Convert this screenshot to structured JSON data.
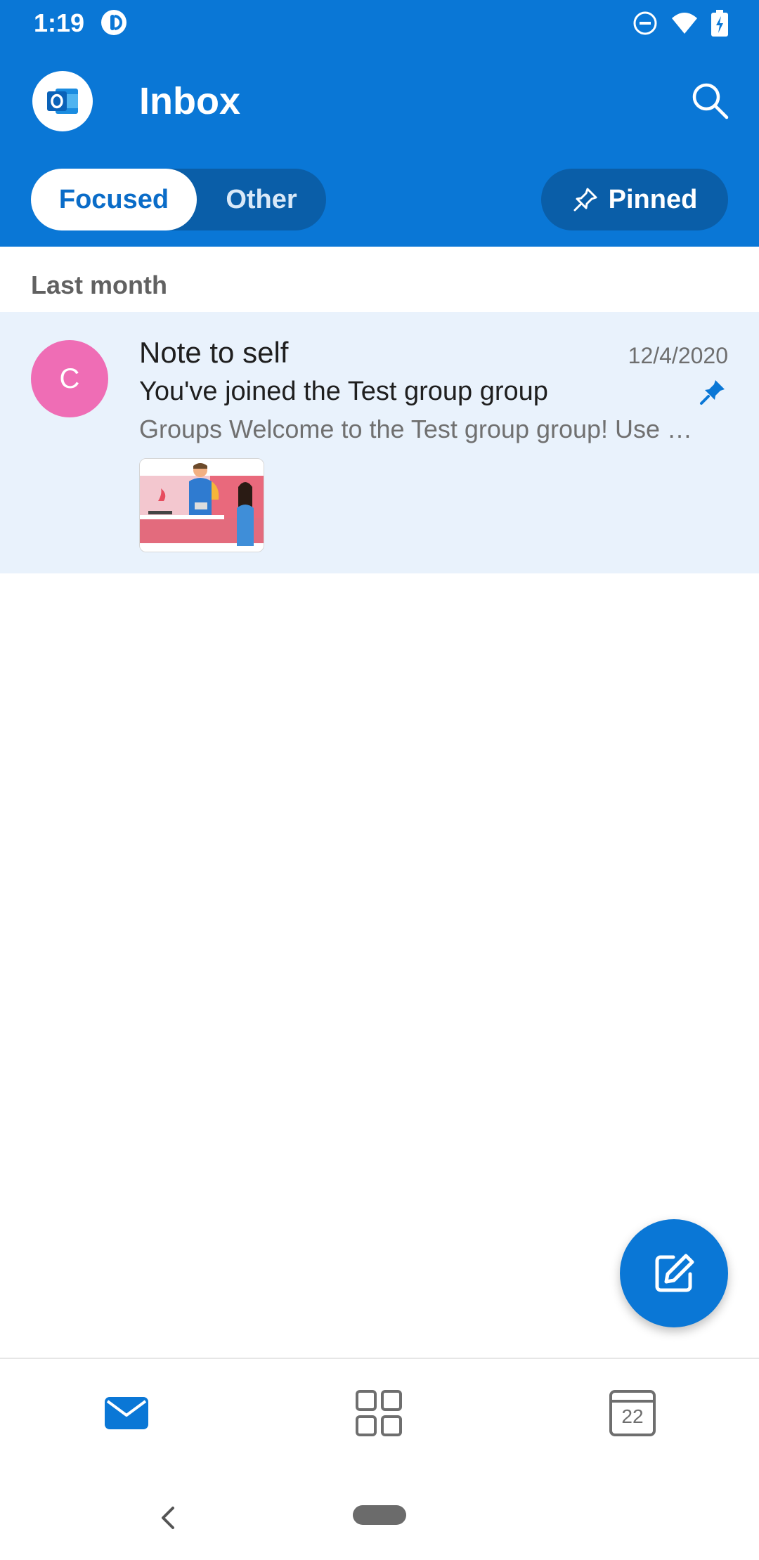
{
  "status_bar": {
    "time": "1:19"
  },
  "header": {
    "title": "Inbox",
    "tabs": {
      "focused": "Focused",
      "other": "Other",
      "selected": "Focused"
    },
    "pinned_label": "Pinned"
  },
  "list": {
    "section_label": "Last month",
    "messages": [
      {
        "avatar_initial": "C",
        "avatar_color": "#ef6db5",
        "sender": "Note to self",
        "date": "12/4/2020",
        "subject": "You've joined the Test group group",
        "preview": "Groups Welcome to the Test group group! Use …",
        "pinned": true
      }
    ]
  },
  "bottom_nav": {
    "items": [
      {
        "icon": "mail-icon",
        "selected": true
      },
      {
        "icon": "apps-icon",
        "selected": false
      },
      {
        "icon": "calendar-icon",
        "day": "22",
        "selected": false
      }
    ]
  },
  "colors": {
    "accent": "#0a77d6",
    "header_dark": "#0a5ea8",
    "selected_row": "#e9f2fc"
  }
}
